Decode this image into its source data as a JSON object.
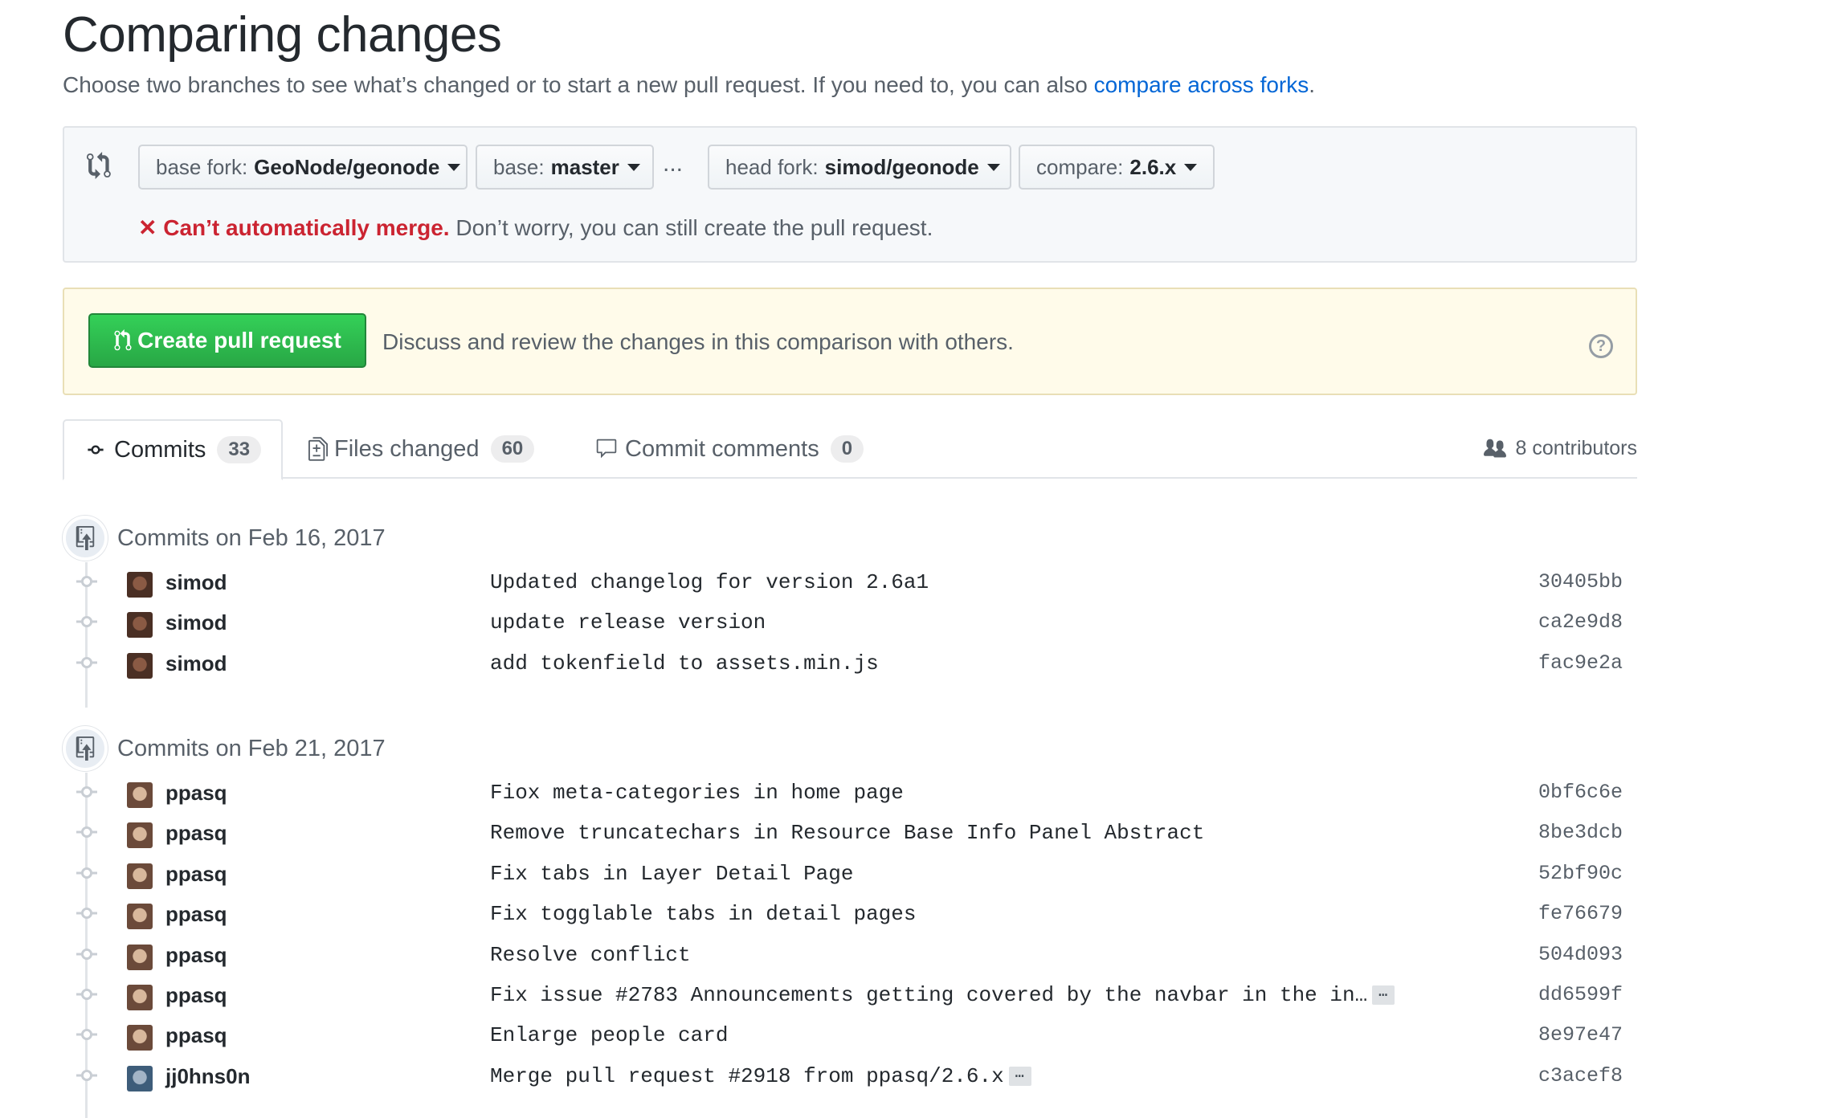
{
  "header": {
    "title": "Comparing changes",
    "subtitle_text": "Choose two branches to see what’s changed or to start a new pull request. If you need to, you can also ",
    "subtitle_link": "compare across forks",
    "subtitle_end": "."
  },
  "range": {
    "base_fork": {
      "label": "base fork:",
      "value": "GeoNode/geonode"
    },
    "base": {
      "label": "base:",
      "value": "master"
    },
    "separator": "...",
    "head_fork": {
      "label": "head fork:",
      "value": "simod/geonode"
    },
    "compare": {
      "label": "compare:",
      "value": "2.6.x"
    },
    "merge_error": "Can’t automatically merge.",
    "merge_note": " Don’t worry, you can still create the pull request."
  },
  "pr": {
    "button_label": "Create pull request",
    "description": "Discuss and review the changes in this comparison with others.",
    "help_glyph": "?"
  },
  "tabs": [
    {
      "label": "Commits",
      "count": "33"
    },
    {
      "label": "Files changed",
      "count": "60"
    },
    {
      "label": "Commit comments",
      "count": "0"
    }
  ],
  "contributors": "8 contributors",
  "groups": [
    {
      "date": "Commits on Feb 16, 2017",
      "commits": [
        {
          "author": "simod",
          "message": "Updated changelog for version 2.6a1",
          "sha": "30405bb",
          "more": ""
        },
        {
          "author": "simod",
          "message": "update release version",
          "sha": "ca2e9d8",
          "more": ""
        },
        {
          "author": "simod",
          "message": "add tokenfield to assets.min.js",
          "sha": "fac9e2a",
          "more": ""
        }
      ]
    },
    {
      "date": "Commits on Feb 21, 2017",
      "commits": [
        {
          "author": "ppasq",
          "message": "Fiox meta-categories in home page",
          "sha": "0bf6c6e",
          "more": ""
        },
        {
          "author": "ppasq",
          "message": "Remove truncatechars in Resource Base Info Panel Abstract",
          "sha": "8be3dcb",
          "more": ""
        },
        {
          "author": "ppasq",
          "message": "Fix tabs in Layer Detail Page",
          "sha": "52bf90c",
          "more": ""
        },
        {
          "author": "ppasq",
          "message": "Fix togglable tabs in detail pages",
          "sha": "fe76679",
          "more": ""
        },
        {
          "author": "ppasq",
          "message": "Resolve conflict",
          "sha": "504d093",
          "more": ""
        },
        {
          "author": "ppasq",
          "message": "Fix issue #2783 Announcements getting covered by the navbar in the in…",
          "sha": "dd6599f",
          "more": "…"
        },
        {
          "author": "ppasq",
          "message": "Enlarge people card",
          "sha": "8e97e47",
          "more": ""
        },
        {
          "author": "jj0hns0n",
          "message": "Merge pull request #2918 from ppasq/2.6.x",
          "sha": "c3acef8",
          "more": "…"
        }
      ]
    }
  ],
  "colors": {
    "link": "#0366d6",
    "error": "#cb2431",
    "pr_button": "#28a745",
    "pr_box_bg": "#fffbea",
    "range_box_bg": "#f6f8fa"
  },
  "icons": {
    "compare": "git-compare-icon",
    "error": "x-icon",
    "pr": "git-pull-request-icon",
    "help": "question-icon",
    "commits": "git-commit-icon",
    "files": "file-diff-icon",
    "comments": "comment-icon",
    "contributors": "people-icon",
    "group": "repo-push-icon"
  }
}
